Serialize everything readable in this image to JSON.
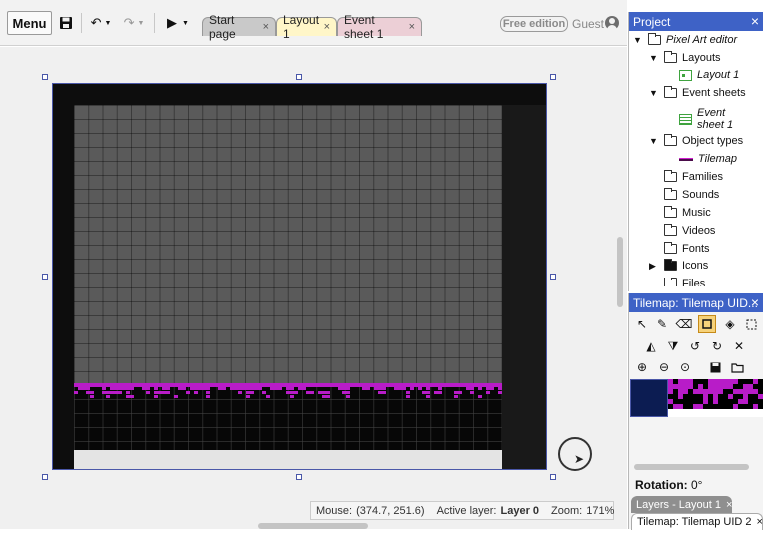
{
  "toolbar": {
    "menu_label": "Menu",
    "tabs": [
      {
        "label": "Start page",
        "close": "×"
      },
      {
        "label": "Layout 1",
        "close": "×"
      },
      {
        "label": "Event sheet 1",
        "close": "×"
      }
    ],
    "free_edition_label": "Free edition",
    "guest_label": "Guest"
  },
  "status": {
    "mouse_label": "Mouse:",
    "mouse_value": "(374.7, 251.6)",
    "active_layer_label": "Active layer:",
    "active_layer_value": "Layer 0",
    "zoom_label": "Zoom:",
    "zoom_value": "171%"
  },
  "project": {
    "title": "Project",
    "close": "×",
    "items": [
      {
        "label": "Pixel Art editor"
      },
      {
        "label": "Layouts"
      },
      {
        "label": "Layout 1"
      },
      {
        "label": "Event sheets"
      },
      {
        "label": "Event sheet 1"
      },
      {
        "label": "Object types"
      },
      {
        "label": "Tilemap"
      },
      {
        "label": "Families"
      },
      {
        "label": "Sounds"
      },
      {
        "label": "Music"
      },
      {
        "label": "Videos"
      },
      {
        "label": "Fonts"
      },
      {
        "label": "Icons"
      },
      {
        "label": "Files"
      }
    ]
  },
  "tilemap_panel": {
    "title": "Tilemap: Tilemap UID...",
    "close": "×",
    "rotation_label": "Rotation:",
    "rotation_value": "0°"
  },
  "bottom_tabs": {
    "layers": "Layers - Layout 1",
    "tilemap": "Tilemap: Tilemap UID 2",
    "close": "×"
  },
  "colors": {
    "accent": "#3e62c6",
    "selection": "#4a57a8",
    "tile_magenta": "#b81cc8",
    "active_tool": "#f6d27a"
  }
}
